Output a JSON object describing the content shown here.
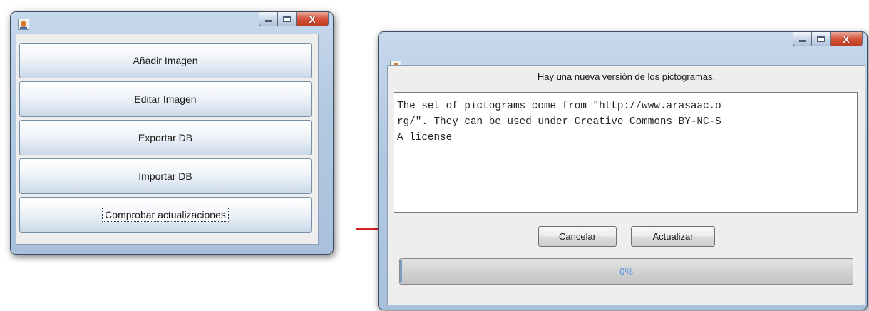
{
  "main_window": {
    "buttons": [
      {
        "label": "Añadir Imagen"
      },
      {
        "label": "Editar Imagen"
      },
      {
        "label": "Exportar DB"
      },
      {
        "label": "Importar DB"
      },
      {
        "label": "Comprobar actualizaciones"
      }
    ],
    "title_controls": {
      "close_glyph": "X"
    }
  },
  "update_dialog": {
    "message": "Hay una nueva versión de los pictogramas.",
    "license_lines": [
      "The set of pictograms come from \"http://www.arasaac.o",
      "rg/\". They can be used under Creative Commons BY-NC-S",
      "A license"
    ],
    "cancel_label": "Cancelar",
    "update_label": "Actualizar",
    "progress": {
      "value": 0,
      "text": "0%"
    },
    "title_controls": {
      "close_glyph": "X"
    }
  },
  "icons": [
    "java-cup-icon",
    "minimize-icon",
    "maximize-icon",
    "close-icon",
    "arrow-icon"
  ],
  "colors": {
    "arrow": "#d42020",
    "progress_text": "#4a90e0",
    "close_button": "#c94a30"
  }
}
